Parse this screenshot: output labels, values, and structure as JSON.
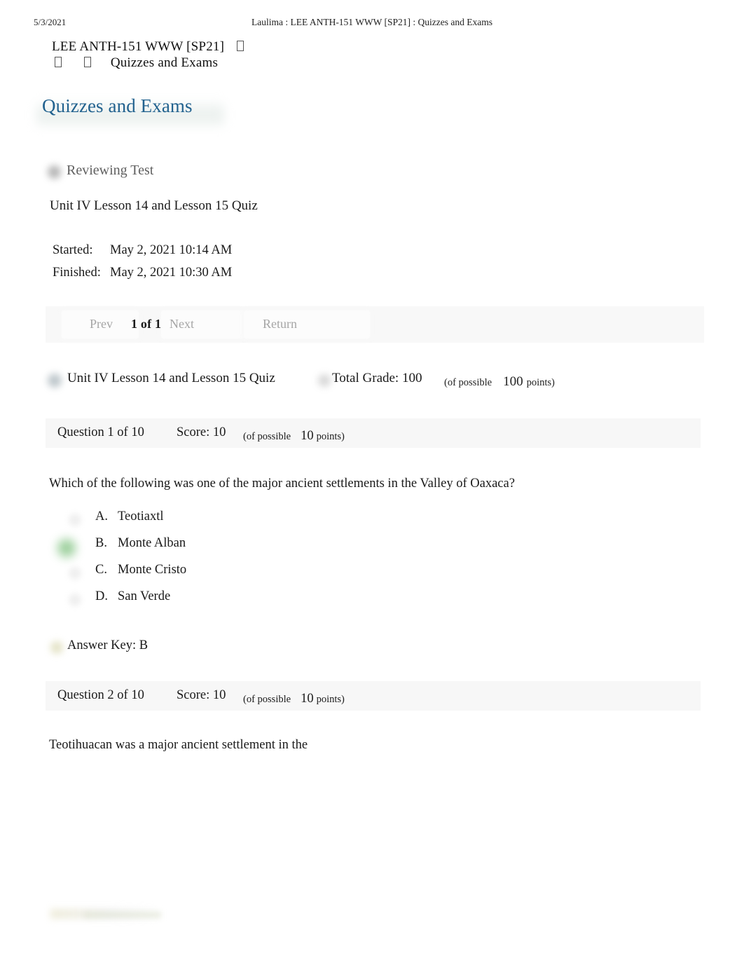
{
  "print_header": {
    "date": "5/3/2021",
    "title": "Laulima : LEE ANTH-151 WWW [SP21] : Quizzes and Exams"
  },
  "breadcrumb": {
    "course": "LEE ANTH-151 WWW [SP21]",
    "tool": "Quizzes and Exams"
  },
  "page": {
    "title": "Quizzes and Exams",
    "title_color": "#22628f",
    "status_label": "Reviewing Test",
    "quiz_name": "Unit IV Lesson 14 and Lesson 15 Quiz"
  },
  "timestamps": {
    "started_label": "Started:",
    "started_value": "May 2, 2021 10:14 AM",
    "finished_label": "Finished:",
    "finished_value": "May 2, 2021 10:30 AM"
  },
  "navigation": {
    "prev_label": "Prev",
    "counter": "1 of 1",
    "next_label": "Next",
    "return_label": "Return"
  },
  "grade_summary": {
    "quiz_name": "Unit IV Lesson 14 and Lesson 15 Quiz",
    "total_grade": "Total Grade: 100",
    "of_possible_label": "(of possible",
    "possible_points": "100",
    "points_suffix": "points)"
  },
  "questions": [
    {
      "header": "Question 1 of 10",
      "score": "Score: 10",
      "of_possible_label": "(of possible",
      "possible_points": "10",
      "points_suffix": "points)",
      "text": "Which of the following was one of the major ancient settlements in the Valley of Oaxaca?",
      "options": [
        {
          "letter": "A.",
          "text": "Teotiaxtl",
          "selected": false
        },
        {
          "letter": "B.",
          "text": "Monte Alban",
          "selected": true
        },
        {
          "letter": "C.",
          "text": "Monte Cristo",
          "selected": false
        },
        {
          "letter": "D.",
          "text": "San Verde",
          "selected": false
        }
      ],
      "answer_key": "Answer Key: B"
    },
    {
      "header": "Question 2 of 10",
      "score": "Score: 10",
      "of_possible_label": "(of possible",
      "possible_points": "10",
      "points_suffix": "points)",
      "text": "Teotihuacan was a major ancient settlement in the"
    }
  ],
  "icons": {
    "status_icon": "gray-circle-icon",
    "quiz_icon": "blue-gray-circle-icon",
    "grade_icon": "gray-circle-icon",
    "selected_option_icon": "green-radio-selected-icon",
    "unselected_option_icon": "gray-radio-icon",
    "answer_key_icon": "khaki-circle-icon"
  }
}
